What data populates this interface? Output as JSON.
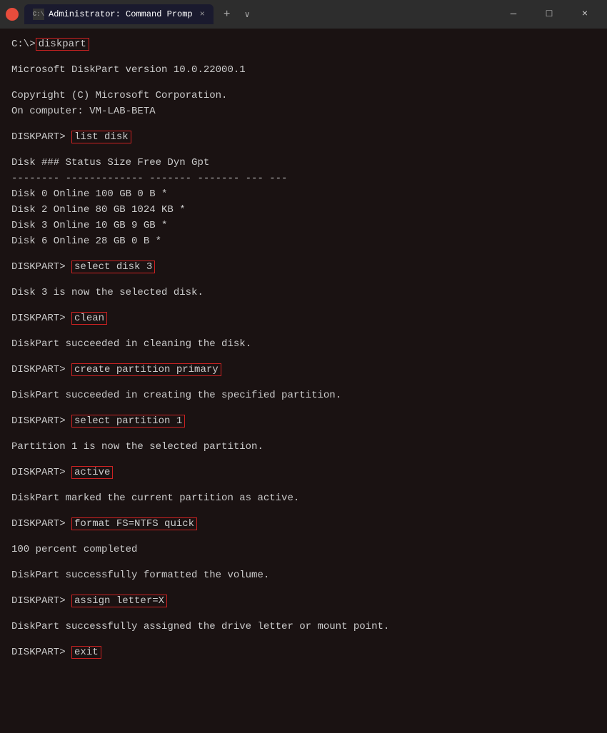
{
  "titlebar": {
    "app_icon": "❤",
    "tab_label": "Administrator: Command Promp",
    "close_label": "×",
    "new_tab_label": "+",
    "dropdown_label": "∨",
    "minimize_label": "—",
    "maximize_label": "□",
    "close_window_label": "×"
  },
  "terminal": {
    "lines": [
      {
        "type": "prompt_cmd",
        "prefix": "C:\\>",
        "cmd": "diskpart"
      },
      {
        "type": "blank"
      },
      {
        "type": "output",
        "text": "Microsoft DiskPart version 10.0.22000.1"
      },
      {
        "type": "blank"
      },
      {
        "type": "output",
        "text": "Copyright (C) Microsoft Corporation."
      },
      {
        "type": "output",
        "text": "On computer: VM-LAB-BETA"
      },
      {
        "type": "blank"
      },
      {
        "type": "diskpart_cmd",
        "cmd": "list disk"
      },
      {
        "type": "blank"
      },
      {
        "type": "table_header",
        "text": "  Disk ###  Status         Size     Free     Dyn  Gpt"
      },
      {
        "type": "separator",
        "text": "  --------  -------------  -------  -------  ---  ---"
      },
      {
        "type": "table_row",
        "text": "  Disk 0    Online          100 GB      0 B        *"
      },
      {
        "type": "table_row",
        "text": "  Disk 2    Online           80 GB  1024 KB        *"
      },
      {
        "type": "table_row",
        "text": "  Disk 3    Online           10 GB     9 GB        *"
      },
      {
        "type": "table_row",
        "text": "  Disk 6    Online           28 GB     0 B         *"
      },
      {
        "type": "blank"
      },
      {
        "type": "diskpart_cmd",
        "cmd": "select disk 3"
      },
      {
        "type": "blank"
      },
      {
        "type": "output",
        "text": "Disk 3 is now the selected disk."
      },
      {
        "type": "blank"
      },
      {
        "type": "diskpart_cmd",
        "cmd": "clean"
      },
      {
        "type": "blank"
      },
      {
        "type": "output",
        "text": "DiskPart succeeded in cleaning the disk."
      },
      {
        "type": "blank"
      },
      {
        "type": "diskpart_cmd",
        "cmd": "create partition primary"
      },
      {
        "type": "blank"
      },
      {
        "type": "output",
        "text": "DiskPart succeeded in creating the specified partition."
      },
      {
        "type": "blank"
      },
      {
        "type": "diskpart_cmd",
        "cmd": "select partition 1"
      },
      {
        "type": "blank"
      },
      {
        "type": "output",
        "text": "Partition 1 is now the selected partition."
      },
      {
        "type": "blank"
      },
      {
        "type": "diskpart_cmd",
        "cmd": "active"
      },
      {
        "type": "blank"
      },
      {
        "type": "output",
        "text": "DiskPart marked the current partition as active."
      },
      {
        "type": "blank"
      },
      {
        "type": "diskpart_cmd",
        "cmd": "format FS=NTFS quick"
      },
      {
        "type": "blank"
      },
      {
        "type": "output",
        "text": "  100 percent completed"
      },
      {
        "type": "blank"
      },
      {
        "type": "output",
        "text": "DiskPart successfully formatted the volume."
      },
      {
        "type": "blank"
      },
      {
        "type": "diskpart_cmd",
        "cmd": "assign letter=X"
      },
      {
        "type": "blank"
      },
      {
        "type": "output",
        "text": "DiskPart successfully assigned the drive letter or mount point."
      },
      {
        "type": "blank"
      },
      {
        "type": "diskpart_cmd",
        "cmd": "exit"
      }
    ]
  }
}
